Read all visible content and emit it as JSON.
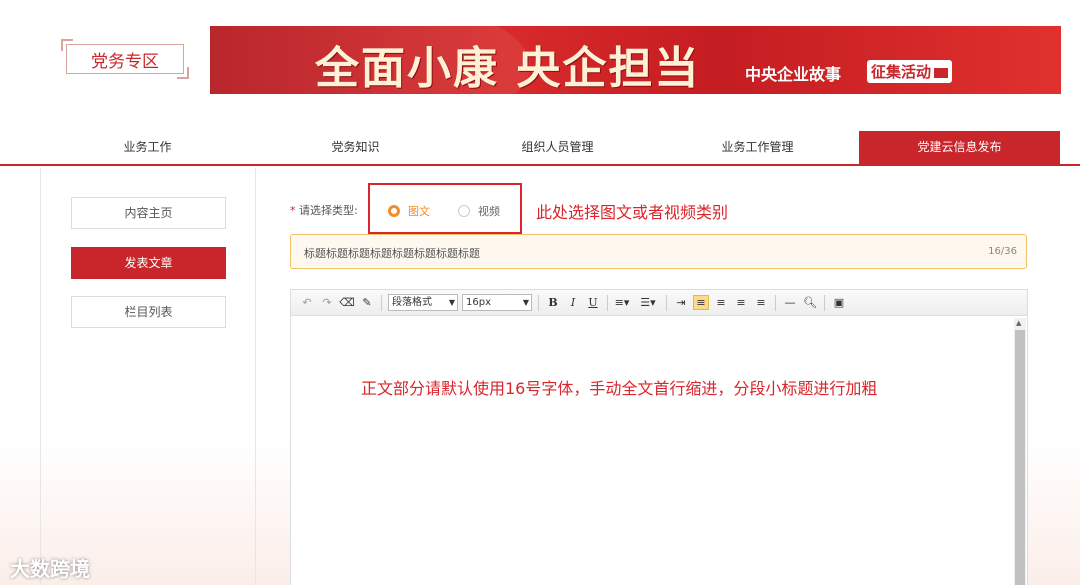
{
  "header": {
    "logo_text": "党务专区",
    "banner_main": "全面小康 央企担当",
    "banner_sub": "中央企业故事",
    "banner_badge": "征集活动"
  },
  "nav": {
    "items": [
      {
        "label": "业务工作",
        "active": false
      },
      {
        "label": "党务知识",
        "active": false
      },
      {
        "label": "组织人员管理",
        "active": false
      },
      {
        "label": "业务工作管理",
        "active": false
      },
      {
        "label": "党建云信息发布",
        "active": true
      }
    ]
  },
  "sidebar": {
    "items": [
      {
        "label": "内容主页",
        "active": false
      },
      {
        "label": "发表文章",
        "active": true
      },
      {
        "label": "栏目列表",
        "active": false
      }
    ]
  },
  "form": {
    "type_required_mark": "*",
    "type_label": "请选择类型:",
    "type_options": [
      {
        "label": "图文",
        "checked": true
      },
      {
        "label": "视频",
        "checked": false
      }
    ],
    "type_annotation": "此处选择图文或者视频类别",
    "title_value": "标题标题标题标题标题标题标题标题",
    "title_count": "16/36"
  },
  "editor": {
    "paragraph_format": "段落格式",
    "font_size": "16px",
    "body_annotation": "正文部分请默认使用16号字体，手动全文首行缩进，分段小标题进行加粗"
  },
  "watermark": "大数跨境",
  "colors": {
    "accent": "#c9262c",
    "radio_checked": "#ef8c2b",
    "annotation": "#d9262c"
  }
}
